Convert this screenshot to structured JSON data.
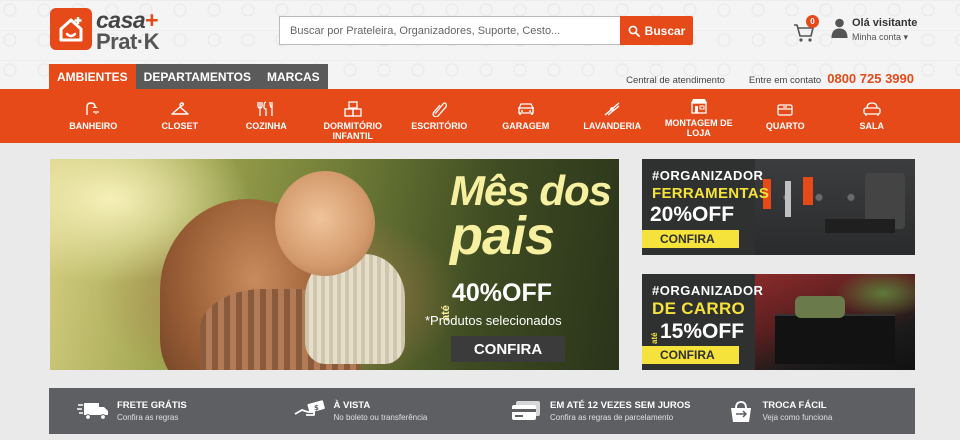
{
  "brand": {
    "line1": "casa",
    "line2": "Prat·K"
  },
  "search": {
    "placeholder": "Buscar por Prateleira, Organizadores, Suporte, Cesto...",
    "button": "Buscar"
  },
  "cart": {
    "count": "0"
  },
  "user": {
    "greeting": "Olá visitante",
    "account": "Minha conta ▾"
  },
  "tabs": [
    {
      "label": "AMBIENTES",
      "active": true
    },
    {
      "label": "DEPARTAMENTOS",
      "active": false
    },
    {
      "label": "MARCAS",
      "active": false
    }
  ],
  "contact": {
    "service": "Central de atendimento",
    "call": "Entre em contato",
    "phone": "0800 725 3990"
  },
  "categories": [
    {
      "label": "BANHEIRO",
      "icon": "shower-icon"
    },
    {
      "label": "CLOSET",
      "icon": "hanger-icon"
    },
    {
      "label": "COZINHA",
      "icon": "cutlery-icon"
    },
    {
      "label": "DORMITÓRIO INFANTIL",
      "icon": "toy-blocks-icon"
    },
    {
      "label": "ESCRITÓRIO",
      "icon": "paperclip-icon"
    },
    {
      "label": "GARAGEM",
      "icon": "car-icon"
    },
    {
      "label": "LAVANDERIA",
      "icon": "clothespin-icon"
    },
    {
      "label": "MONTAGEM DE LOJA",
      "icon": "store-icon"
    },
    {
      "label": "QUARTO",
      "icon": "box-icon"
    },
    {
      "label": "SALA",
      "icon": "armchair-icon"
    }
  ],
  "hero": {
    "title1": "Mês dos",
    "title2": "pais",
    "ate": "até",
    "off": "40%OFF",
    "note": "*Produtos selecionados",
    "cta": "CONFIRA"
  },
  "promos": [
    {
      "tag": "#ORGANIZADOR",
      "title": "FERRAMENTAS",
      "ate": "",
      "off": "20%OFF",
      "cta": "CONFIRA"
    },
    {
      "tag": "#ORGANIZADOR",
      "title": "DE CARRO",
      "ate": "até",
      "off": "15%OFF",
      "cta": "CONFIRA"
    }
  ],
  "benefits": [
    {
      "title": "FRETE GRÁTIS",
      "sub": "Confira as regras",
      "icon": "truck-icon"
    },
    {
      "title": "À VISTA",
      "sub": "No boleto ou transferência",
      "icon": "cash-hand-icon"
    },
    {
      "title": "EM ATÉ 12 VEZES SEM JUROS",
      "sub": "Confira as regras de parcelamento",
      "icon": "credit-card-icon"
    },
    {
      "title": "TROCA FÁCIL",
      "sub": "Veja como funciona",
      "icon": "exchange-bag-icon"
    }
  ],
  "colors": {
    "accent": "#e64a19",
    "dark": "#5a5a5a",
    "promo_yellow": "#f5e23a"
  }
}
